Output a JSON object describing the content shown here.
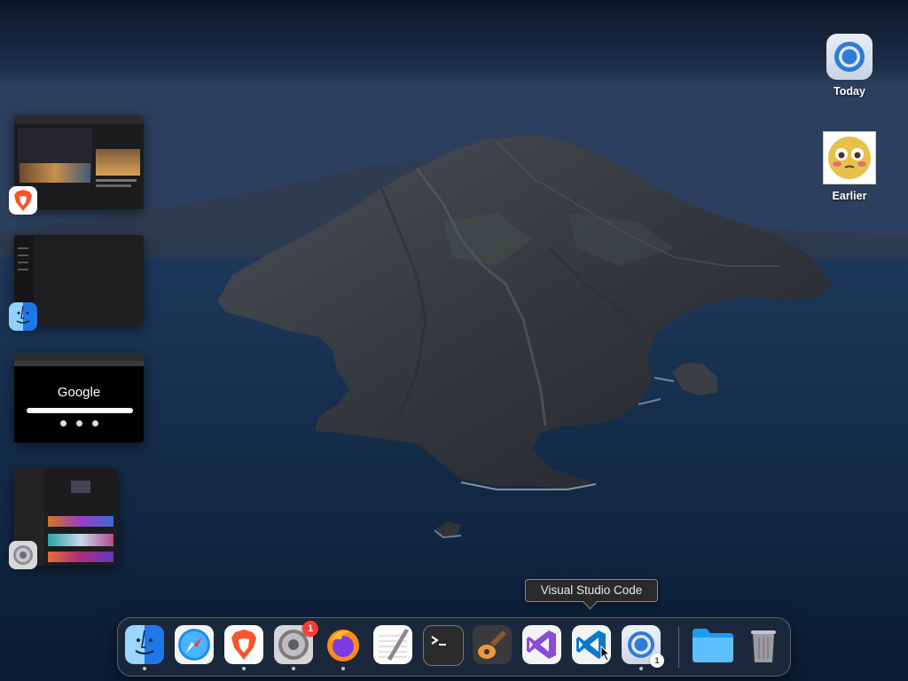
{
  "desktop": {
    "items": [
      {
        "label": "Today",
        "icon": "chrome-icon"
      },
      {
        "label": "Earlier",
        "icon": "emoji-face-icon"
      }
    ]
  },
  "stage_manager": {
    "windows": [
      {
        "app": "Brave Browser",
        "icon": "brave-icon"
      },
      {
        "app": "Finder",
        "icon": "finder-icon"
      },
      {
        "app": "Google Chrome",
        "icon": "chrome-icon",
        "content_title": "Google"
      },
      {
        "app": "System Settings",
        "icon": "settings-gear-icon"
      }
    ]
  },
  "dock": {
    "apps": [
      {
        "name": "Finder",
        "icon": "finder-icon",
        "running": true
      },
      {
        "name": "Safari",
        "icon": "safari-icon",
        "running": false
      },
      {
        "name": "Brave Browser",
        "icon": "brave-icon",
        "running": true
      },
      {
        "name": "System Settings",
        "icon": "settings-gear-icon",
        "running": true,
        "badge": "1"
      },
      {
        "name": "Firefox",
        "icon": "firefox-icon",
        "running": true
      },
      {
        "name": "TextEdit",
        "icon": "textedit-icon",
        "running": false
      },
      {
        "name": "Terminal",
        "icon": "terminal-icon",
        "running": false
      },
      {
        "name": "GarageBand",
        "icon": "guitar-icon",
        "running": false
      },
      {
        "name": "Visual Studio",
        "icon": "visual-studio-icon",
        "running": false
      },
      {
        "name": "Visual Studio Code",
        "icon": "vscode-icon",
        "running": false
      },
      {
        "name": "Google Chrome",
        "icon": "chrome-icon",
        "running": true,
        "mini_badge": "1"
      }
    ],
    "right": [
      {
        "name": "Downloads folder",
        "icon": "folder-icon"
      },
      {
        "name": "Trash",
        "icon": "trash-icon"
      }
    ],
    "tooltip": "Visual Studio Code"
  },
  "colors": {
    "brave": "#fb542b",
    "vscode": "#0a7acc",
    "badge": "#ff3b30",
    "sea": "#1a3556"
  }
}
